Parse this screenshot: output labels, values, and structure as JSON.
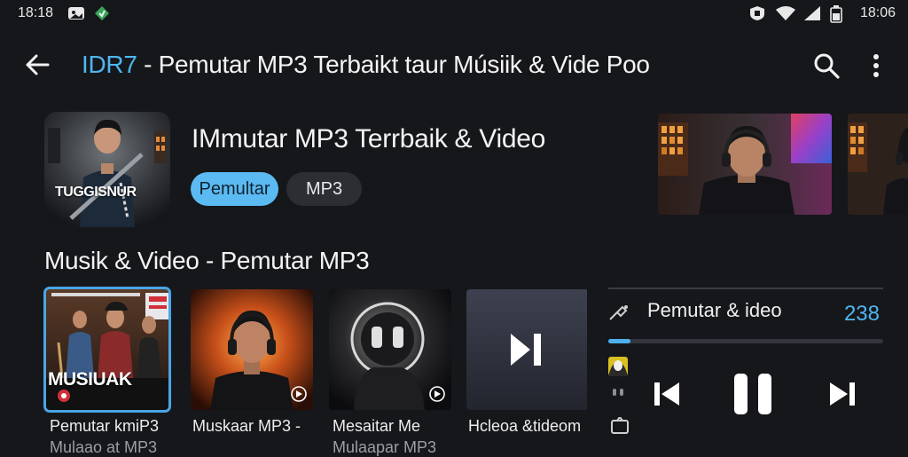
{
  "status_bar": {
    "time_left": "18:18",
    "time_right": "18:06"
  },
  "header": {
    "title_accent": "IDR7",
    "title_rest": " - Pemutar MP3 Terbaikt taur Músiik & Vide Poo"
  },
  "album": {
    "art_text": "TUGGISNUR",
    "title": "IMmutar MP3 Terrbaik & Video",
    "chips": [
      "Pemultar",
      "MP3"
    ]
  },
  "section": {
    "title": "Musik & Video - Pemutar MP3"
  },
  "cards": [
    {
      "label": "Pemutar kmiP3",
      "sublabel": "Mulaao at MP3",
      "art_text": "MUSIUAK"
    },
    {
      "label": "Muskaar MP3 -",
      "sublabel": ""
    },
    {
      "label": "Mesaitar Me",
      "sublabel": "Mulaapar MP3"
    },
    {
      "label": "Hcleoa &tideom",
      "sublabel": ""
    }
  ],
  "player": {
    "title": "Pemutar & ideo",
    "count": "238",
    "progress": 0.08
  },
  "colors": {
    "accent": "#4fb6ef",
    "background": "#16171b",
    "chip_active": "#5bbaf2"
  },
  "icons": [
    "back-arrow-icon",
    "search-icon",
    "more-vert-icon",
    "skip-previous-icon",
    "pause-icon",
    "skip-next-icon",
    "pin-icon",
    "cast-icon"
  ]
}
